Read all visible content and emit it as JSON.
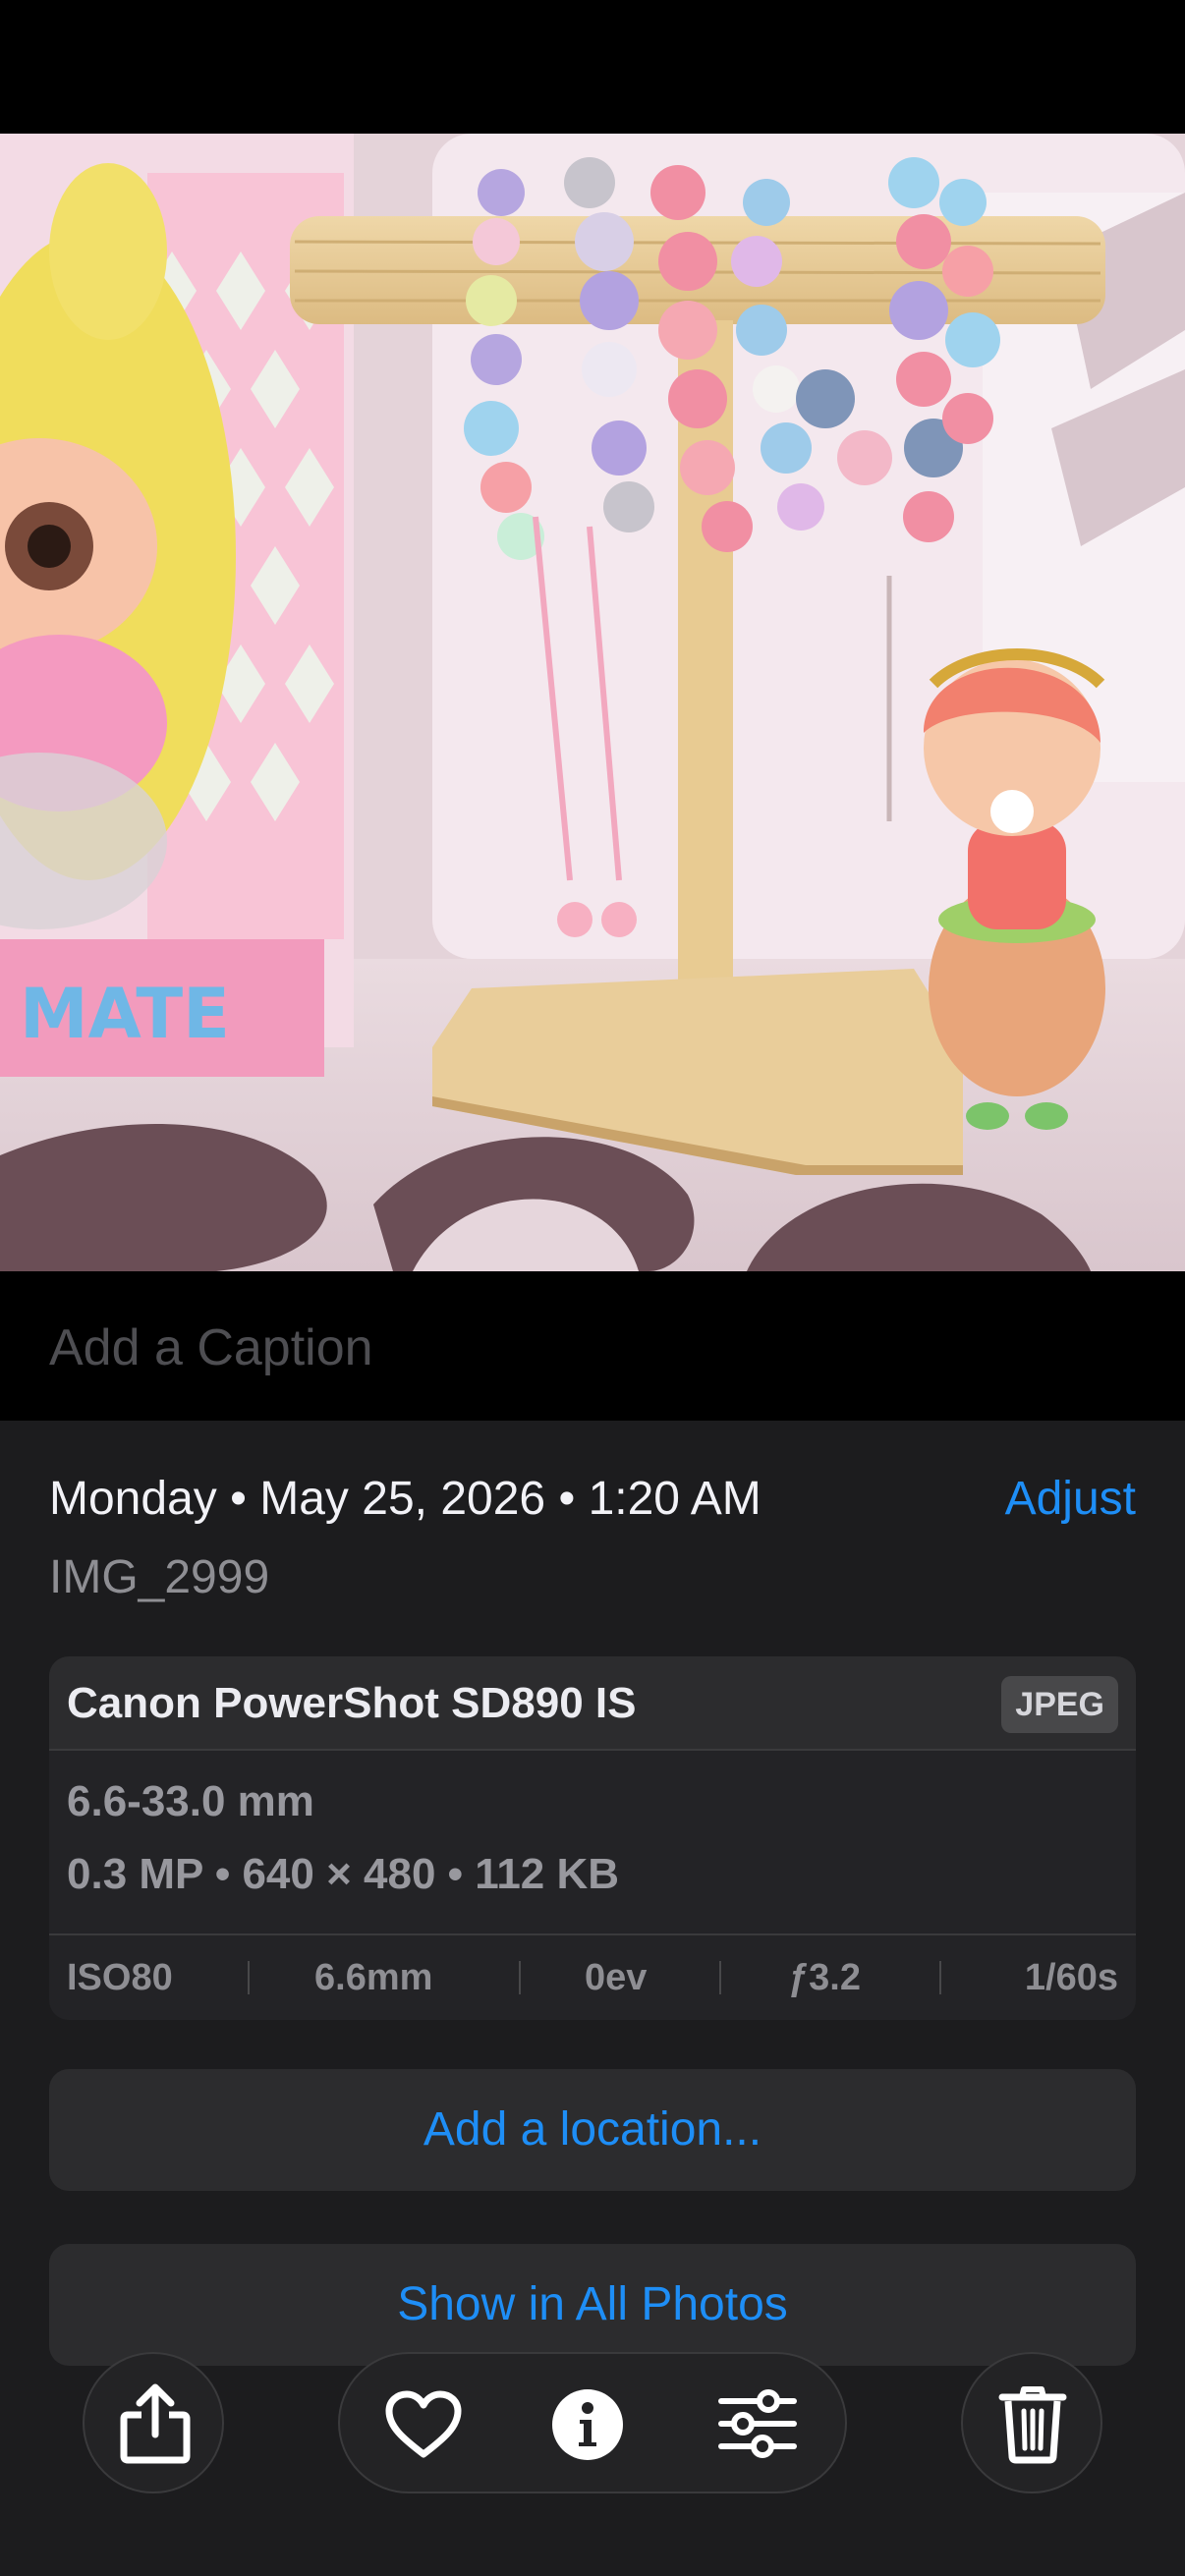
{
  "caption": {
    "placeholder": "Add a Caption"
  },
  "info": {
    "date": "Monday • May 25, 2026 • 1:20 AM",
    "adjust_label": "Adjust",
    "filename": "IMG_2999"
  },
  "camera": {
    "name": "Canon PowerShot SD890 IS",
    "format": "JPEG",
    "lens": "6.6-33.0 mm",
    "specs": "0.3 MP • 640 × 480 • 112 KB",
    "exif": {
      "iso": "ISO80",
      "focal": "6.6mm",
      "ev": "0ev",
      "aperture": "ƒ3.2",
      "shutter": "1/60s"
    }
  },
  "actions": {
    "add_location": "Add a location...",
    "show_all": "Show in All Photos"
  },
  "toolbar": {
    "icons": [
      "share-icon",
      "heart-icon",
      "info-icon",
      "sliders-icon",
      "trash-icon"
    ]
  },
  "colors": {
    "accent": "#1e8ef6",
    "sheet_bg": "#1c1c1e",
    "card_bg": "#2c2c2e"
  }
}
